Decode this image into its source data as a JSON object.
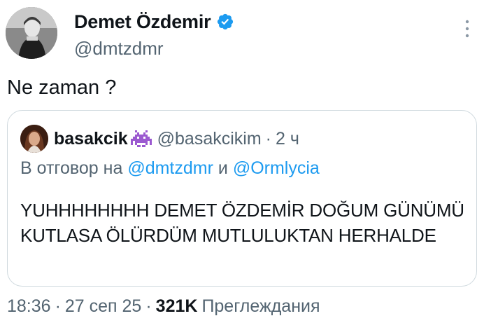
{
  "author": {
    "name": "Demet Özdemir",
    "handle": "@dmtzdmr"
  },
  "tweet": {
    "text": "Ne zaman ?"
  },
  "quote": {
    "name": "basakcik",
    "handle": "@basakcikim",
    "separator": "·",
    "time": "2 ч",
    "reply_prefix": "В отговор на",
    "reply_mention_1": "@dmtzdmr",
    "reply_conj": "и",
    "reply_mention_2": "@Ormlycia",
    "body": "YUHHHHHHHH DEMET ÖZDEMİR DOĞUM GÜNÜMÜ KUTLASA ÖLÜRDÜM MUTLULUKTAN HERHALDE"
  },
  "meta": {
    "time": "18:36",
    "separator": "·",
    "date": "27 сеп 25",
    "views_count": "321K",
    "views_label": "Преглеждания"
  },
  "colors": {
    "text": "#0f1419",
    "secondary": "#536471",
    "link": "#1d9bf0",
    "verified": "#1d9bf0",
    "border": "#cfd9de"
  },
  "icons": {
    "verified": "verified-badge-icon",
    "more": "more-vertical-icon",
    "alien": "alien-emoji-icon"
  }
}
